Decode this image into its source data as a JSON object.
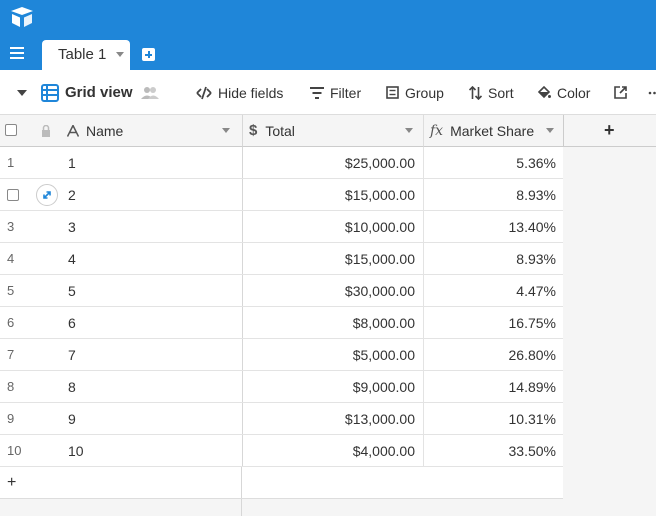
{
  "app": {
    "logo_icon": "airtable-logo-icon",
    "accent": "#1f86d9"
  },
  "tabs": [
    {
      "label": "Table 1",
      "active": true
    }
  ],
  "toolbar": {
    "view_name": "Grid view",
    "hide_fields": "Hide fields",
    "filter": "Filter",
    "group": "Group",
    "sort": "Sort",
    "color": "Color"
  },
  "columns": [
    {
      "label": "Name",
      "icon": "text-field-icon"
    },
    {
      "label": "Total",
      "icon": "currency-field-icon"
    },
    {
      "label": "Market Share",
      "icon": "formula-field-icon"
    }
  ],
  "rows": [
    {
      "num": "1",
      "name": "1",
      "total": "$25,000.00",
      "share": "5.36%"
    },
    {
      "num": "2",
      "name": "2",
      "total": "$15,000.00",
      "share": "8.93%"
    },
    {
      "num": "3",
      "name": "3",
      "total": "$10,000.00",
      "share": "13.40%"
    },
    {
      "num": "4",
      "name": "4",
      "total": "$15,000.00",
      "share": "8.93%"
    },
    {
      "num": "5",
      "name": "5",
      "total": "$30,000.00",
      "share": "4.47%"
    },
    {
      "num": "6",
      "name": "6",
      "total": "$8,000.00",
      "share": "16.75%"
    },
    {
      "num": "7",
      "name": "7",
      "total": "$5,000.00",
      "share": "26.80%"
    },
    {
      "num": "8",
      "name": "8",
      "total": "$9,000.00",
      "share": "14.89%"
    },
    {
      "num": "9",
      "name": "9",
      "total": "$13,000.00",
      "share": "10.31%"
    },
    {
      "num": "10",
      "name": "10",
      "total": "$4,000.00",
      "share": "33.50%"
    }
  ],
  "add_column_label": "+",
  "add_row_label": "+"
}
